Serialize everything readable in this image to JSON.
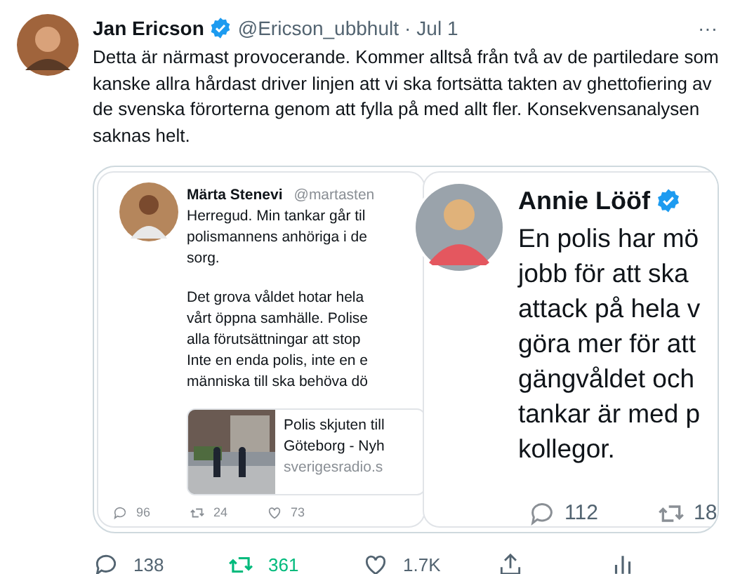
{
  "tweet": {
    "author": {
      "name": "Jan Ericson",
      "verified": true,
      "handle": "@Ericson_ubbhult"
    },
    "separator": "·",
    "date": "Jul 1",
    "more": "···",
    "text": "Detta är närmast provocerande. Kommer alltså från två av de partiledare som kanske allra hårdast driver linjen att vi ska fortsätta takten av ghettofiering av de svenska förorterna genom att fylla på med allt fler. Konsekvensanalysen  saknas helt.",
    "media": {
      "left_tweet": {
        "name": "Märta Stenevi",
        "handle": "@martasten",
        "paragraphs": [
          [
            "Herregud. Min tankar går til",
            "polismannens anhöriga i de",
            "sorg."
          ],
          [
            "Det grova våldet hotar hela",
            "vårt öppna samhälle. Polise",
            "alla förutsättningar att stop",
            "Inte en enda polis, inte en e",
            "människa till ska behöva dö"
          ]
        ],
        "link_card": {
          "title_lines": [
            "Polis skjuten till",
            "Göteborg - Nyh"
          ],
          "domain": "sverigesradio.s"
        },
        "stats": [
          {
            "kind": "reply",
            "count": "96"
          },
          {
            "kind": "retweet",
            "count": "24"
          },
          {
            "kind": "like",
            "count": "73"
          }
        ]
      },
      "right_tweet": {
        "name": "Annie Lööf",
        "verified": true,
        "lines": [
          "En polis har mö",
          "jobb för att ska",
          "attack på hela v",
          "göra mer för att",
          "gängvåldet och",
          "tankar är med p",
          "kollegor."
        ],
        "stats": [
          {
            "kind": "reply",
            "count": "112"
          },
          {
            "kind": "retweet",
            "count": "18"
          }
        ]
      }
    },
    "actions": [
      {
        "kind": "reply",
        "count": "138",
        "active": false
      },
      {
        "kind": "retweet",
        "count": "361",
        "active": true
      },
      {
        "kind": "like",
        "count": "1.7K",
        "active": false
      },
      {
        "kind": "share"
      },
      {
        "kind": "analytics"
      }
    ]
  }
}
